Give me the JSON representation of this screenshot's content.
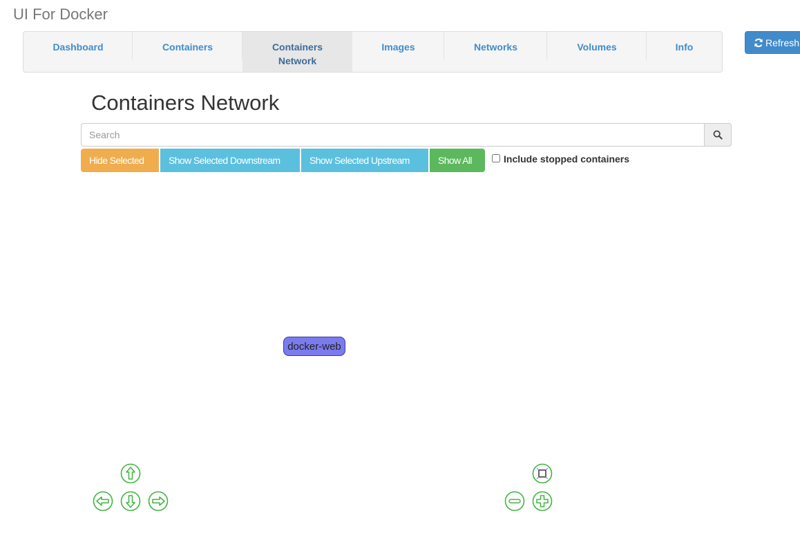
{
  "app": {
    "title": "UI For Docker"
  },
  "nav": {
    "items": [
      {
        "label": "Dashboard",
        "active": false
      },
      {
        "label": "Containers",
        "active": false
      },
      {
        "label": "Containers Network",
        "active": true
      },
      {
        "label": "Images",
        "active": false
      },
      {
        "label": "Networks",
        "active": false
      },
      {
        "label": "Volumes",
        "active": false
      },
      {
        "label": "Info",
        "active": false
      }
    ],
    "refresh_label": "Refresh"
  },
  "page": {
    "title": "Containers Network",
    "search": {
      "placeholder": "Search",
      "value": ""
    },
    "buttons": {
      "hide_selected": "Hide Selected",
      "show_downstream": "Show Selected Downstream",
      "show_upstream": "Show Selected Upstream",
      "show_all": "Show All"
    },
    "include_stopped": {
      "label": "Include stopped containers",
      "checked": false
    }
  },
  "graph": {
    "nodes": [
      {
        "label": "docker-web"
      }
    ],
    "controls": {
      "pan": [
        "up",
        "left",
        "down",
        "right"
      ],
      "zoom": [
        "fit",
        "zoom-out",
        "zoom-in"
      ],
      "color": "#3fb53f"
    }
  }
}
